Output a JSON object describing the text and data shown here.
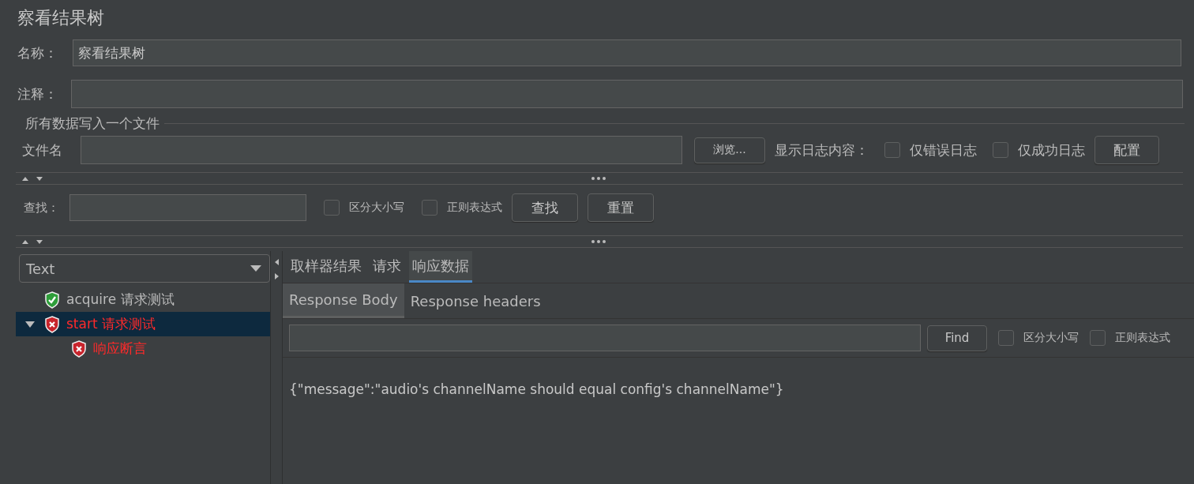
{
  "title": "察看结果树",
  "name_field": {
    "label": "名称：",
    "value": "察看结果树"
  },
  "comment_field": {
    "label": "注释："
  },
  "file_group": {
    "legend": "所有数据写入一个文件",
    "label": "文件名",
    "browse": "浏览...",
    "log_label": "显示日志内容：",
    "options": [
      {
        "label": "仅错误日志",
        "checked": false
      },
      {
        "label": "仅成功日志",
        "checked": false
      }
    ],
    "config": "配置"
  },
  "search": {
    "label": "查找：",
    "options": [
      {
        "label": "区分大小写",
        "checked": false
      },
      {
        "label": "正则表达式",
        "checked": false
      }
    ],
    "buttons": [
      "查找",
      "重置"
    ]
  },
  "renderer": {
    "value": "Text"
  },
  "tree": [
    {
      "label": "acquire 请求测试",
      "kind": "pass",
      "selected": false
    },
    {
      "label": "start 请求测试",
      "kind": "fail",
      "selected": true,
      "expanded": true,
      "children": [
        {
          "label": "响应断言",
          "kind": "fail",
          "selected": false
        }
      ]
    }
  ],
  "tabs": [
    {
      "label": "取样器结果",
      "selected": false
    },
    {
      "label": "请求",
      "selected": false
    },
    {
      "label": "响应数据",
      "selected": true
    }
  ],
  "subtabs": [
    {
      "label": "Response Body",
      "selected": true
    },
    {
      "label": "Response headers",
      "selected": false
    }
  ],
  "find": {
    "button": "Find",
    "options": [
      {
        "label": "区分大小写",
        "checked": false
      },
      {
        "label": "正则表达式",
        "checked": false
      }
    ]
  },
  "body": "{\"message\":\"audio's channelName should equal config's channelName\"}"
}
